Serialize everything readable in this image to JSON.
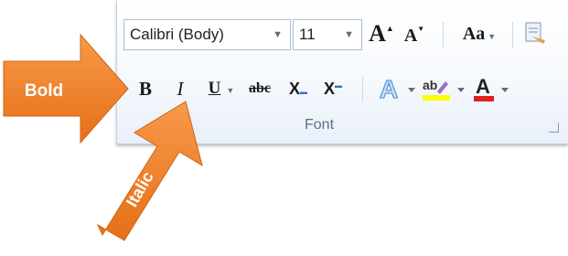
{
  "ribbon": {
    "font_name": "Calibri (Body)",
    "font_size": "11",
    "grow_font": "A",
    "shrink_font": "A",
    "change_case": "Aa",
    "bold": "B",
    "italic": "I",
    "underline": "U",
    "strikethrough": "abc",
    "subscript": "X",
    "superscript": "X",
    "text_effects": "A",
    "highlight": "ab",
    "font_color": "A",
    "group_label": "Font"
  },
  "callouts": {
    "bold": "Bold",
    "italic": "Italic"
  },
  "colors": {
    "arrow": "#f07f2c",
    "highlight_yellow": "#ffff00",
    "font_color_red": "#e02020",
    "text_effects_blue": "#5b9bd5"
  }
}
